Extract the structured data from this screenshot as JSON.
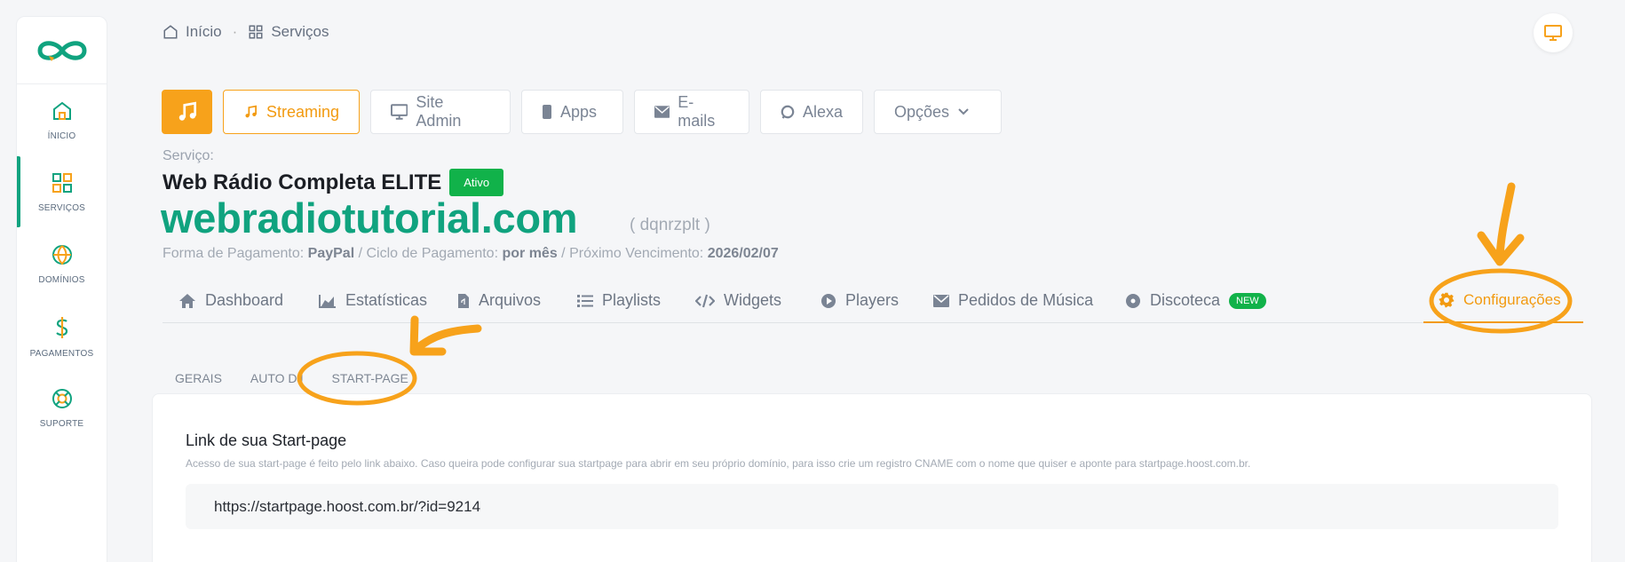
{
  "breadcrumb": {
    "home": "Início",
    "separator": "·",
    "current": "Serviços"
  },
  "sidebar": {
    "items": [
      {
        "label": "ÍNICIO",
        "icon": "home-icon"
      },
      {
        "label": "SERVIÇOS",
        "icon": "grid-icon",
        "active": true
      },
      {
        "label": "DOMÍNIOS",
        "icon": "globe-icon"
      },
      {
        "label": "PAGAMENTOS",
        "icon": "dollar-icon"
      },
      {
        "label": "SUPORTE",
        "icon": "lifebuoy-icon"
      }
    ]
  },
  "top_buttons": {
    "streaming": "Streaming",
    "site_admin": "Site Admin",
    "apps": "Apps",
    "emails": "E-mails",
    "alexa": "Alexa",
    "opcoes": "Opções"
  },
  "service": {
    "label": "Serviço:",
    "name": "Web Rádio Completa ELITE",
    "status": "Ativo",
    "domain": "webradiotutorial.com",
    "id": "( dqnrzplt )",
    "payment_label": "Forma de Pagamento:",
    "payment_value": "PayPal",
    "cycle_label": "/ Ciclo de Pagamento:",
    "cycle_value": "por mês",
    "due_label": "/ Próximo Vencimento:",
    "due_value": "2026/02/07"
  },
  "nav": {
    "dashboard": "Dashboard",
    "estatisticas": "Estatísticas",
    "arquivos": "Arquivos",
    "playlists": "Playlists",
    "widgets": "Widgets",
    "players": "Players",
    "pedidos": "Pedidos de Música",
    "discoteca": "Discoteca",
    "new_badge": "NEW",
    "configuracoes": "Configurações"
  },
  "subtabs": [
    "GERAIS",
    "AUTO DJ",
    "START-PAGE"
  ],
  "startpage": {
    "title": "Link de sua Start-page",
    "description": "Acesso de sua start-page é feito pelo link abaixo. Caso queira pode configurar sua startpage para abrir em seu próprio domínio, para isso crie um registro CNAME com o nome que quiser e aponte para startpage.hoost.com.br.",
    "url": "https://startpage.hoost.com.br/?id=9214"
  },
  "colors": {
    "accent": "#f7a21b",
    "brand": "#10a37f",
    "success": "#11b24a"
  }
}
